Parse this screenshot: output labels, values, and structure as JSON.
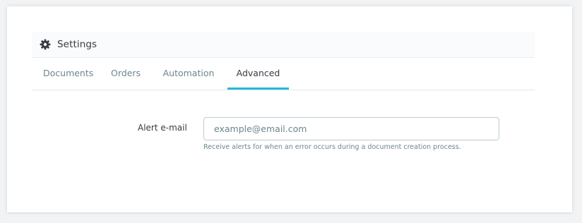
{
  "panel": {
    "title": "Settings",
    "icon": "gear-icon"
  },
  "tabs": [
    {
      "label": "Documents",
      "active": false
    },
    {
      "label": "Orders",
      "active": false
    },
    {
      "label": "Automation",
      "active": false
    },
    {
      "label": "Advanced",
      "active": true
    }
  ],
  "form": {
    "alert_email": {
      "label": "Alert e-mail",
      "value": "",
      "placeholder": "example@email.com",
      "help": "Receive alerts for when an error occurs during a document creation process."
    }
  },
  "colors": {
    "accent": "#25b9d7",
    "text": "#363a41",
    "muted": "#6c868e",
    "border": "#bbcdd2"
  }
}
